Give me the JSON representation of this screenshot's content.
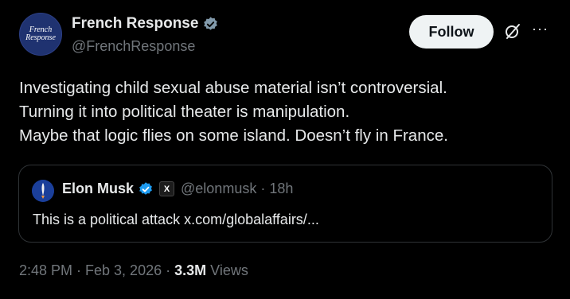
{
  "author": {
    "display_name": "French Response",
    "handle": "@FrenchResponse",
    "avatar_line1": "French",
    "avatar_line2": "Response",
    "verified": true
  },
  "actions": {
    "follow_label": "Follow",
    "grok_icon": "grok-icon",
    "more_icon": "more-icon"
  },
  "tweet": {
    "lines": [
      "Investigating child sexual abuse material isn’t controversial.",
      "Turning it into political theater is manipulation.",
      "Maybe that logic flies on some island. Doesn’t fly in France."
    ]
  },
  "quote": {
    "display_name": "Elon Musk",
    "badge": "X",
    "handle_time": "@elonmusk · 18h",
    "text": "This is a political attack x.com/globalaffairs/..."
  },
  "meta": {
    "time_date": "2:48 PM · Feb 3, 2026 · ",
    "views_count": "3.3M",
    "views_label": " Views"
  },
  "colors": {
    "background": "#000000",
    "text_primary": "#e7e9ea",
    "text_secondary": "#71767b",
    "verified_blue": "#1d9bf0",
    "border": "#2f3336"
  }
}
